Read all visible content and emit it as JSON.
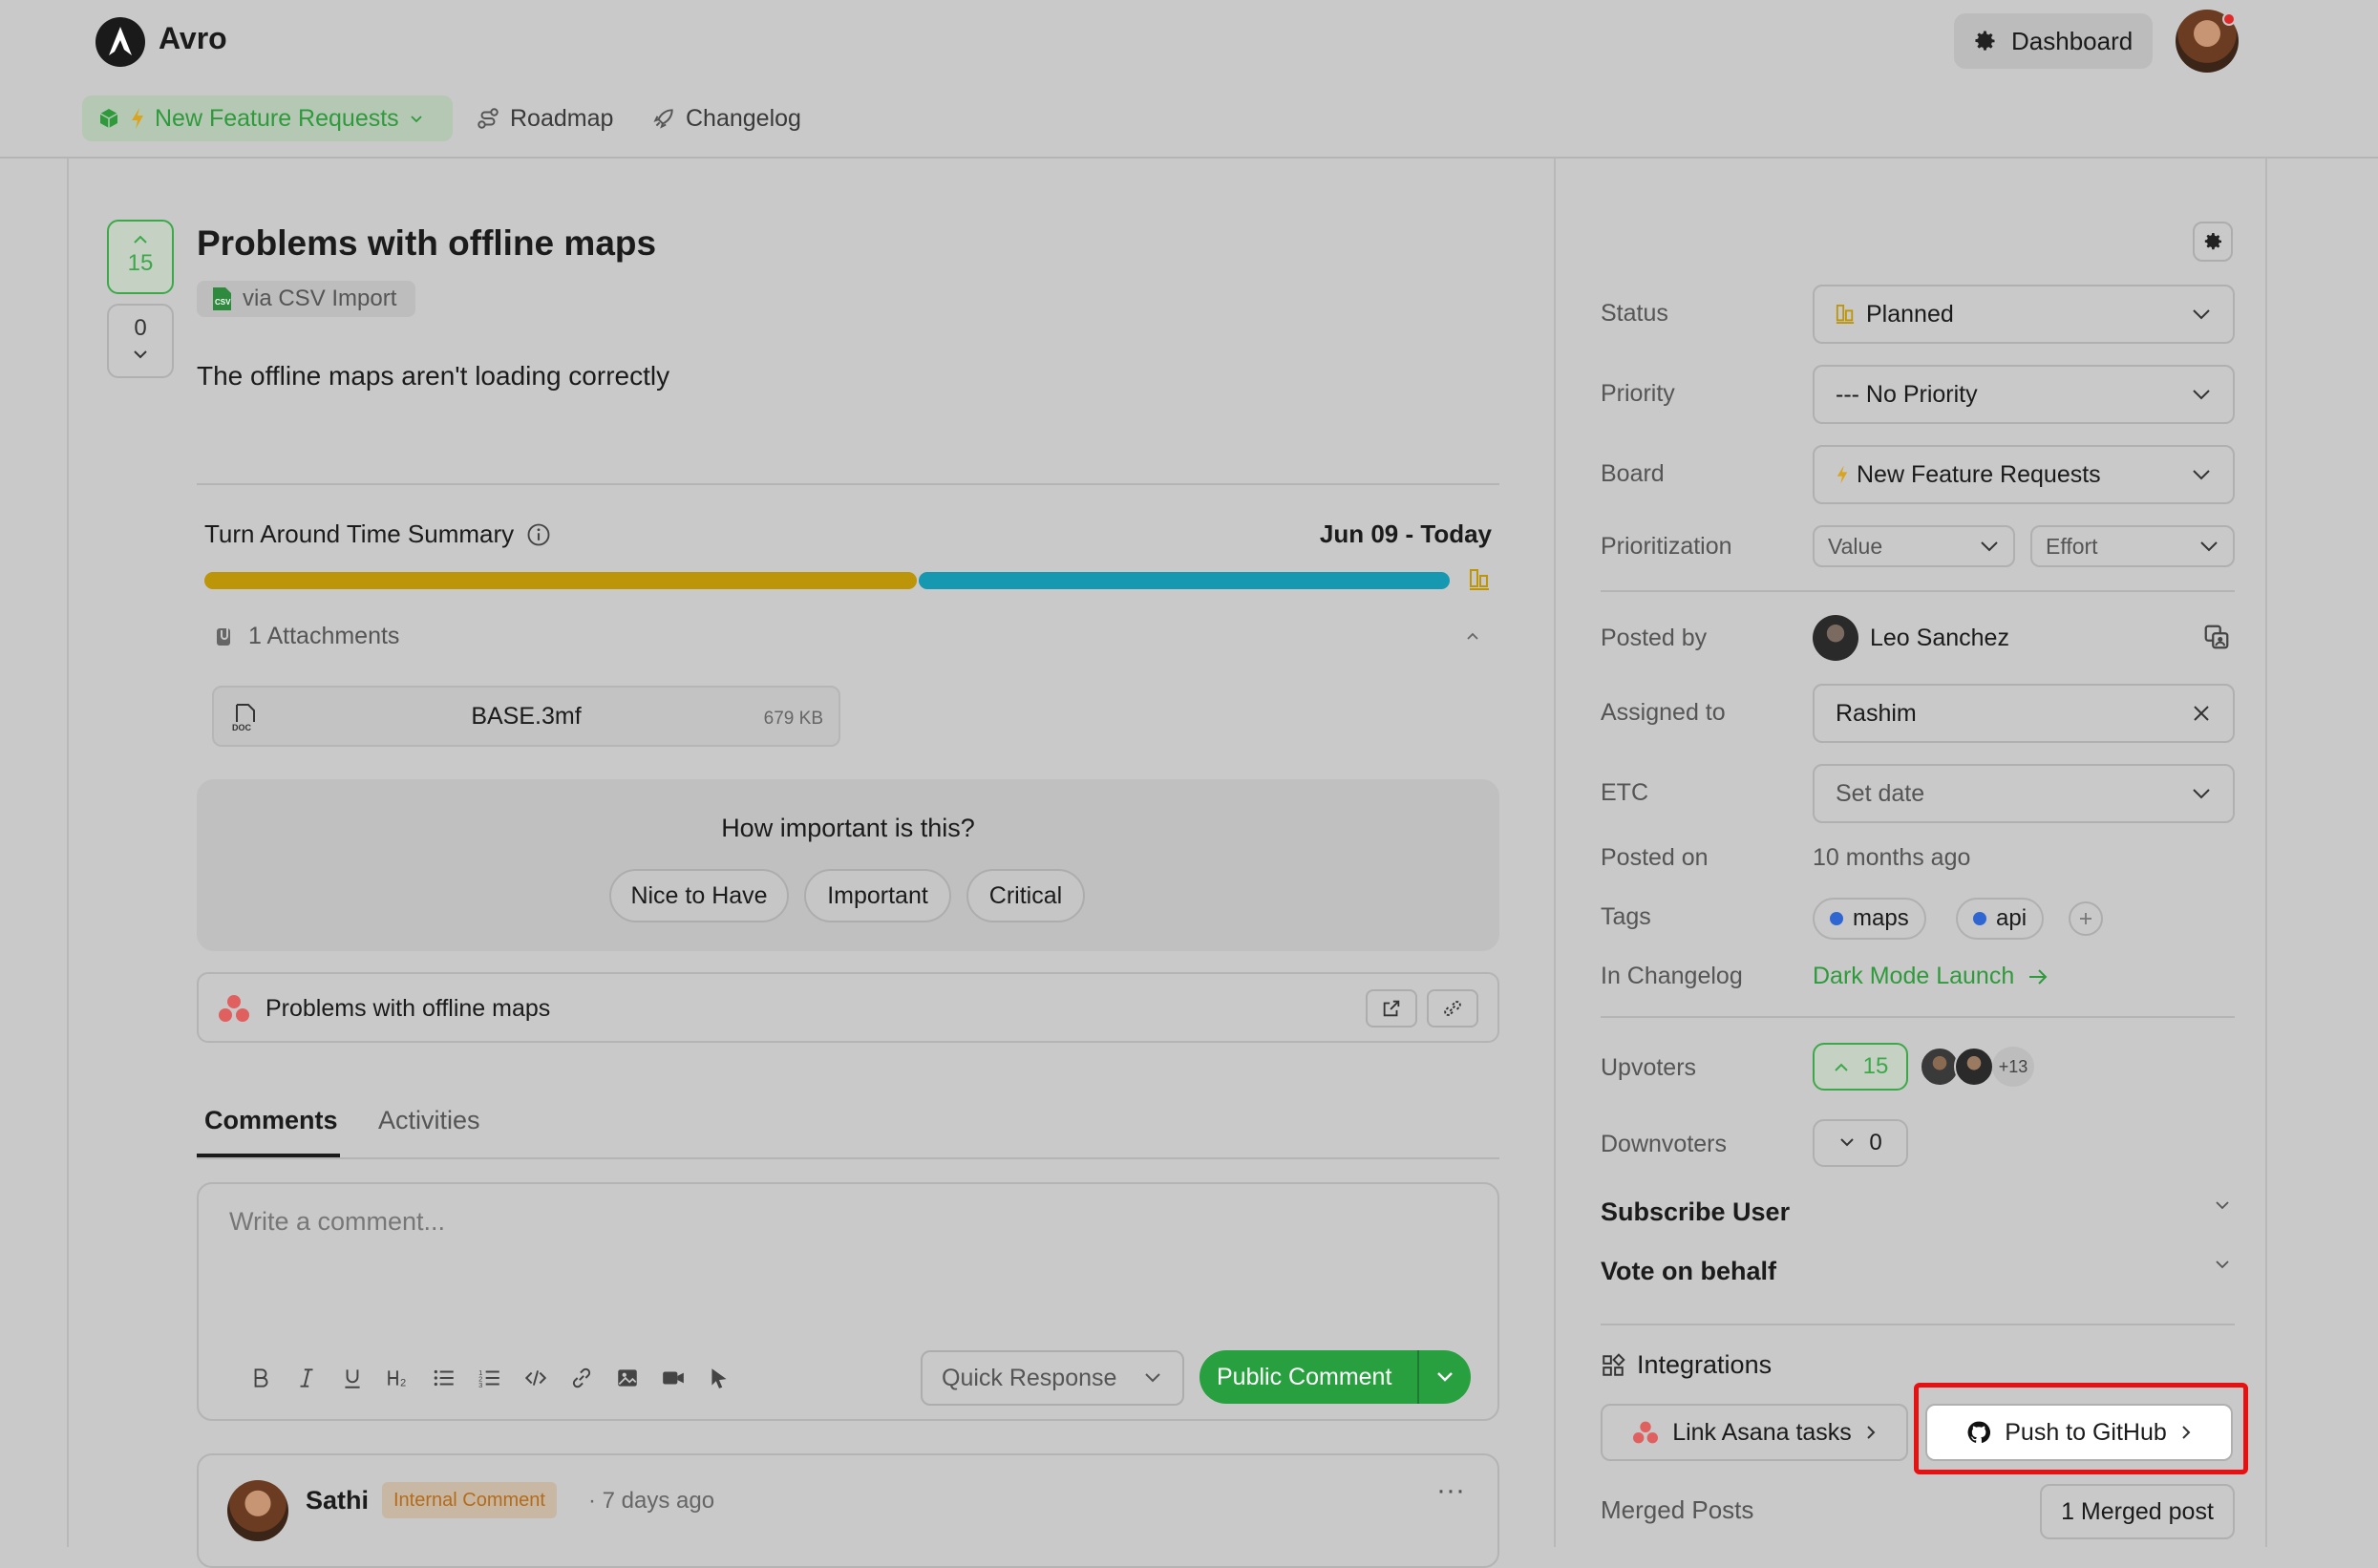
{
  "app": {
    "name": "Avro"
  },
  "header": {
    "dashboard_label": "Dashboard",
    "nav": {
      "board_label": "New Feature Requests",
      "roadmap_label": "Roadmap",
      "changelog_label": "Changelog"
    }
  },
  "post": {
    "upvotes": "15",
    "downvotes": "0",
    "title": "Problems with offline maps",
    "source": "via CSV Import",
    "body": "The offline maps aren't loading correctly"
  },
  "turnaround": {
    "title": "Turn Around Time Summary",
    "range": "Jun 09 - Today",
    "segments": [
      {
        "name": "gold",
        "color": "#bc9509"
      },
      {
        "name": "blue",
        "color": "#1698b0"
      }
    ]
  },
  "attachments": {
    "label": "1 Attachments",
    "files": [
      {
        "name": "BASE.3mf",
        "size": "679 KB",
        "icon_text": "DOC"
      }
    ]
  },
  "importance": {
    "question": "How important is this?",
    "options": [
      "Nice to Have",
      "Important",
      "Critical"
    ]
  },
  "asana_link": {
    "title": "Problems with offline maps"
  },
  "tabs": {
    "comments": "Comments",
    "activities": "Activities"
  },
  "composer": {
    "placeholder": "Write a comment...",
    "quick_response": "Quick Response",
    "submit": "Public Comment"
  },
  "comment": {
    "author": "Sathi",
    "badge": "Internal Comment",
    "time": "· 7 days ago",
    "menu": "···"
  },
  "sidebar": {
    "status": {
      "label": "Status",
      "value": "Planned"
    },
    "priority": {
      "label": "Priority",
      "value": "--- No Priority"
    },
    "board": {
      "label": "Board",
      "value": "New Feature Requests"
    },
    "prioritization": {
      "label": "Prioritization",
      "value_label": "Value",
      "effort_label": "Effort"
    },
    "posted_by": {
      "label": "Posted by",
      "value": "Leo Sanchez"
    },
    "assigned_to": {
      "label": "Assigned to",
      "value": "Rashim"
    },
    "etc": {
      "label": "ETC",
      "value": "Set date"
    },
    "posted_on": {
      "label": "Posted on",
      "value": "10 months ago"
    },
    "tags": {
      "label": "Tags",
      "items": [
        "maps",
        "api"
      ]
    },
    "in_changelog": {
      "label": "In Changelog",
      "value": "Dark Mode Launch"
    },
    "upvoters": {
      "label": "Upvoters",
      "count": "15",
      "more": "+13"
    },
    "downvoters": {
      "label": "Downvoters",
      "count": "0"
    },
    "subscribe_user": "Subscribe User",
    "vote_on_behalf": "Vote on behalf",
    "integrations": {
      "title": "Integrations",
      "asana_button": "Link Asana tasks",
      "github_button": "Push to GitHub"
    },
    "merged_posts": {
      "label": "Merged Posts",
      "value": "1 Merged post"
    }
  },
  "colors": {
    "accent_green": "#29a040",
    "highlight_red": "#e81010",
    "tag_blue": "#2f66d1"
  }
}
